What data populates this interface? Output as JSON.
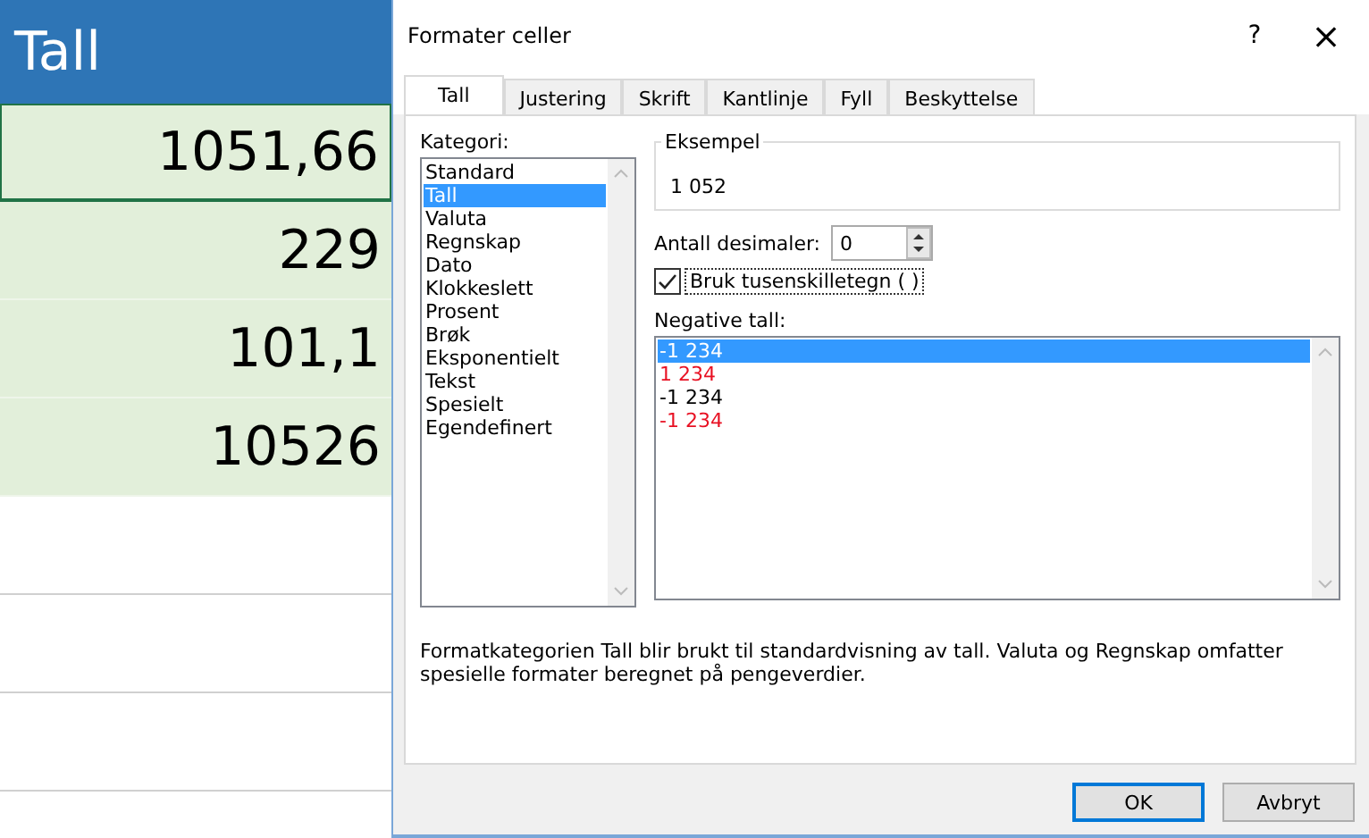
{
  "sheet": {
    "header": "Tall",
    "cells": [
      {
        "value": "1051,66",
        "selected": true
      },
      {
        "value": "229",
        "selected": false
      },
      {
        "value": "101,1",
        "selected": false
      },
      {
        "value": "10526",
        "selected": false
      }
    ]
  },
  "dialog": {
    "title": "Formater celler",
    "help": "?",
    "close": "×",
    "tabs": [
      {
        "label": "Tall",
        "selected": true
      },
      {
        "label": "Justering",
        "selected": false
      },
      {
        "label": "Skrift",
        "selected": false
      },
      {
        "label": "Kantlinje",
        "selected": false
      },
      {
        "label": "Fyll",
        "selected": false
      },
      {
        "label": "Beskyttelse",
        "selected": false
      }
    ],
    "category_label": "Kategori:",
    "categories": [
      {
        "label": "Standard",
        "selected": false
      },
      {
        "label": "Tall",
        "selected": true
      },
      {
        "label": "Valuta",
        "selected": false
      },
      {
        "label": "Regnskap",
        "selected": false
      },
      {
        "label": "Dato",
        "selected": false
      },
      {
        "label": "Klokkeslett",
        "selected": false
      },
      {
        "label": "Prosent",
        "selected": false
      },
      {
        "label": "Brøk",
        "selected": false
      },
      {
        "label": "Eksponentielt",
        "selected": false
      },
      {
        "label": "Tekst",
        "selected": false
      },
      {
        "label": "Spesielt",
        "selected": false
      },
      {
        "label": "Egendefinert",
        "selected": false
      }
    ],
    "sample": {
      "legend": "Eksempel",
      "value": "1 052"
    },
    "decimals": {
      "label": "Antall desimaler:",
      "value": "0"
    },
    "thousands": {
      "label": "Bruk tusenskilletegn ( )",
      "checked": true
    },
    "negative_label": "Negative tall:",
    "negatives": [
      {
        "label": "-1 234",
        "kind": "plain",
        "selected": true
      },
      {
        "label": "1 234",
        "kind": "red",
        "selected": false
      },
      {
        "label": "-1 234",
        "kind": "plain",
        "selected": false
      },
      {
        "label": "-1 234",
        "kind": "red",
        "selected": false
      }
    ],
    "description": "Formatkategorien Tall blir brukt til standardvisning av tall. Valuta og Regnskap omfatter spesielle formater beregnet på pengeverdier.",
    "buttons": [
      {
        "label": "OK",
        "kind": "default"
      },
      {
        "label": "Avbryt",
        "kind": "normal"
      }
    ]
  }
}
